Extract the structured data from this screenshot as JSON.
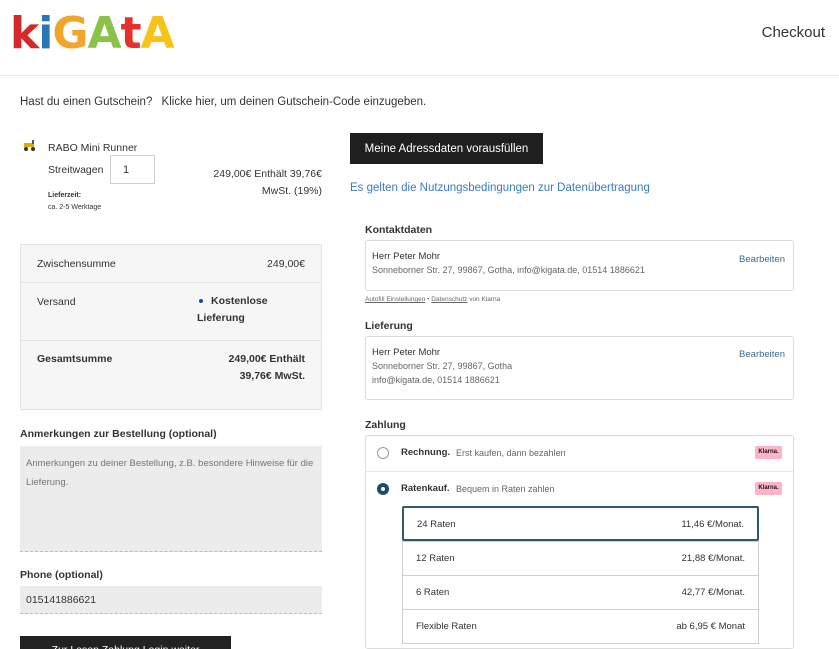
{
  "header": {
    "logo_letters": [
      {
        "ch": "k",
        "color": "#d6282b"
      },
      {
        "ch": "i",
        "color": "#2a74b8"
      },
      {
        "ch": "G",
        "color": "#f2a52b"
      },
      {
        "ch": "A",
        "color": "#8bc34a"
      },
      {
        "ch": "t",
        "color": "#e5322d"
      },
      {
        "ch": "A",
        "color": "#f6c31a"
      }
    ],
    "title": "Checkout"
  },
  "coupon": {
    "question": "Hast du einen Gutschein?",
    "link": "Klicke hier, um deinen Gutschein-Code einzugeben."
  },
  "product": {
    "icon": "product-thumbnail-icon",
    "name": "RABO Mini Runner",
    "variant": "Streitwagen",
    "quantity": "1",
    "price": "249,00€ Enthält 39,76€ MwSt. (19%)",
    "delivery_label": "Lieferzeit:",
    "delivery_value": "ca. 2-5 Werktage"
  },
  "totals": {
    "subtotal_label": "Zwischensumme",
    "subtotal_value": "249,00€",
    "shipping_label": "Versand",
    "shipping_value": "Kostenlose Lieferung",
    "total_label": "Gesamtsumme",
    "total_value": "249,00€ Enthält 39,76€ MwSt."
  },
  "notes": {
    "label": "Anmerkungen zur Bestellung (optional)",
    "placeholder": "Anmerkungen zu deiner Bestellung, z.B. besondere Hinweise für die Lieferung."
  },
  "phone": {
    "label": "Phone (optional)",
    "value": "015141886621"
  },
  "bottom_button": {
    "label": "Zur Lesen Zahlung Login weiter"
  },
  "prefill": {
    "button_label": "Meine Adressdaten vorausfüllen",
    "terms_link": "Es gelten die Nutzungsbedingungen zur Datenübertragung"
  },
  "contact": {
    "title": "Kontaktdaten",
    "name": "Herr Peter Mohr",
    "details": "Sonneborner Str. 27, 99867, Gotha, info@kigata.de, 01514 1886621",
    "edit": "Bearbeiten"
  },
  "klarna_footer": {
    "autofill": "Autofill Einstellungen",
    "separator": " • ",
    "privacy": "Datenschutz",
    "suffix": " von Klarna"
  },
  "delivery": {
    "title": "Lieferung",
    "name": "Herr Peter Mohr",
    "address": "Sonneborner Str. 27, 99867, Gotha",
    "contact": "info@kigata.de, 01514 1886621",
    "edit": "Bearbeiten"
  },
  "payment": {
    "title": "Zahlung",
    "badge": "Klarna.",
    "methods": [
      {
        "name": "Rechnung.",
        "desc": "Erst kaufen, dann bezahlen",
        "selected": false
      },
      {
        "name": "Ratenkauf.",
        "desc": "Bequem in Raten zahlen",
        "selected": true
      }
    ],
    "plans": [
      {
        "label": "24 Raten",
        "amount": "11,46 €/Monat.",
        "selected": true
      },
      {
        "label": "12 Raten",
        "amount": "21,88 €/Monat.",
        "selected": false
      },
      {
        "label": "6 Raten",
        "amount": "42,77 €/Monat.",
        "selected": false
      },
      {
        "label": "Flexible Raten",
        "amount": "ab 6,95 € Monat",
        "selected": false
      }
    ]
  }
}
